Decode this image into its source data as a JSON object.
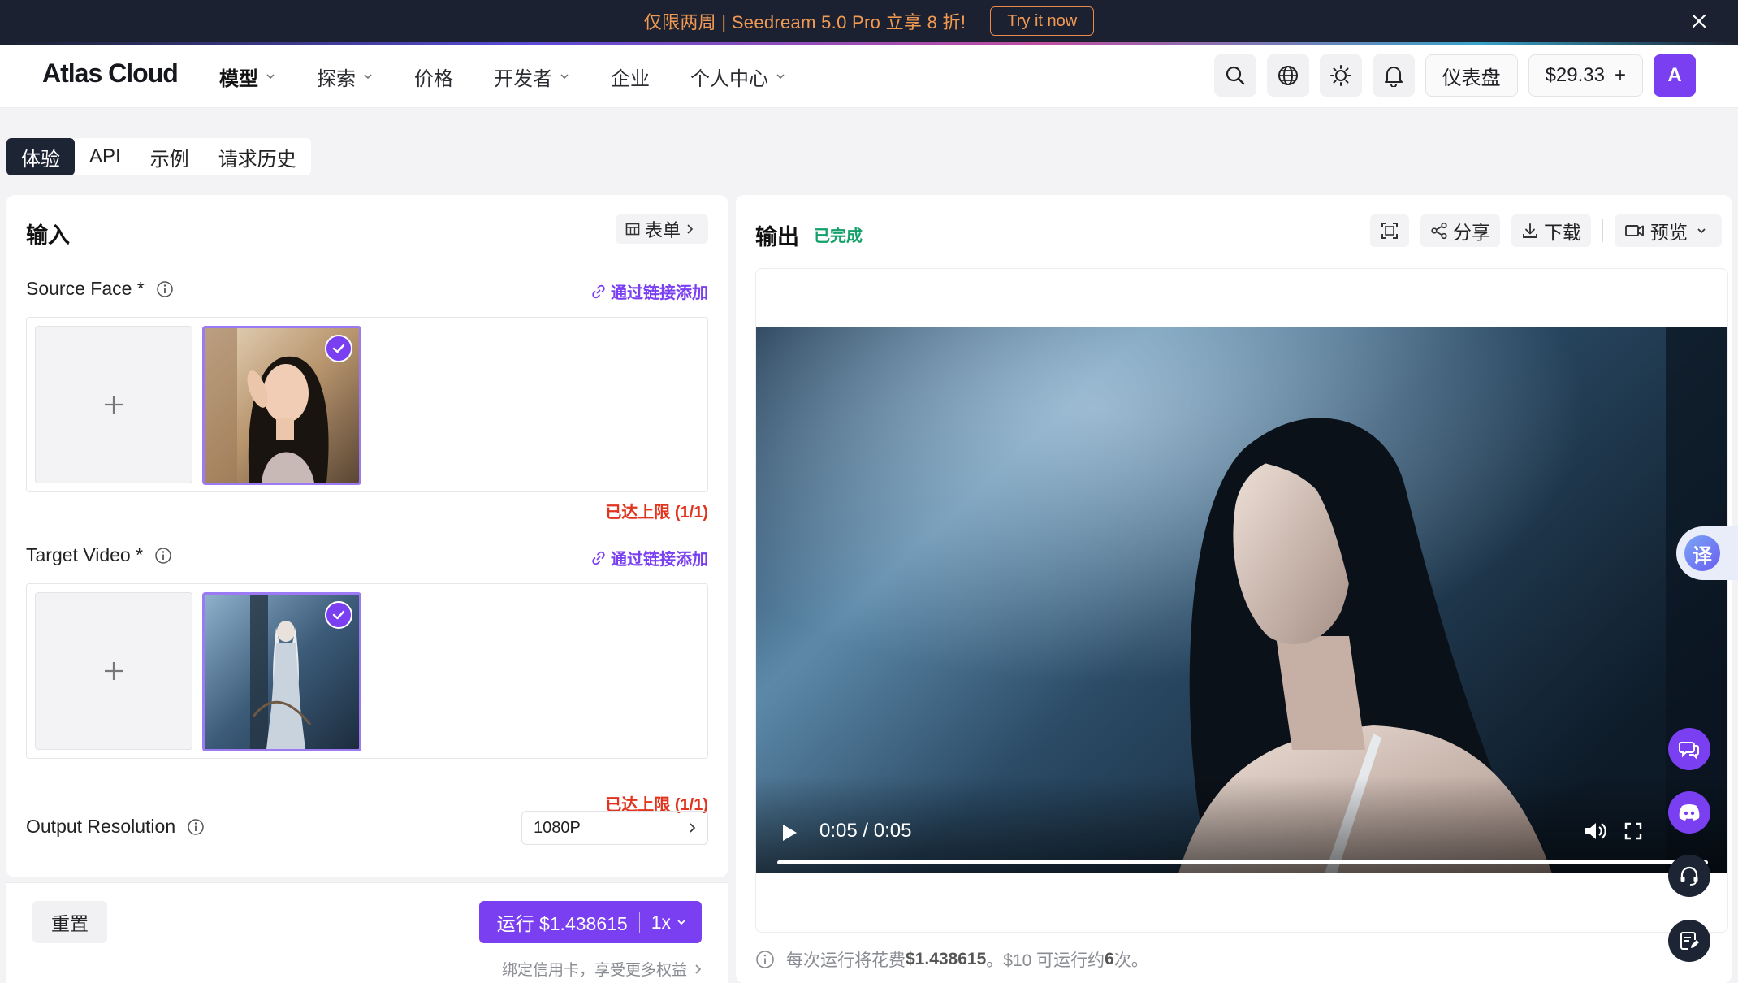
{
  "banner": {
    "text": "仅限两周 | Seedream 5.0 Pro 立享 8 折!",
    "cta": "Try it now"
  },
  "nav": {
    "logo": "Atlas Cloud",
    "menu": [
      {
        "label": "模型",
        "has_dropdown": true
      },
      {
        "label": "探索",
        "has_dropdown": true
      },
      {
        "label": "价格",
        "has_dropdown": false
      },
      {
        "label": "开发者",
        "has_dropdown": true
      },
      {
        "label": "企业",
        "has_dropdown": false
      },
      {
        "label": "个人中心",
        "has_dropdown": true
      }
    ],
    "dashboard": "仪表盘",
    "balance": "$29.33",
    "balance_plus": "+",
    "avatar_letter": "A"
  },
  "tabs": [
    "体验",
    "API",
    "示例",
    "请求历史"
  ],
  "input": {
    "title": "输入",
    "form_toggle": "表单",
    "source_face": {
      "label": "Source Face *",
      "link_add": "通过链接添加",
      "limit": "已达上限 (1/1)"
    },
    "target_video": {
      "label": "Target Video *",
      "link_add": "通过链接添加",
      "limit": "已达上限 (1/1)"
    },
    "resolution": {
      "label": "Output Resolution",
      "value": "1080P"
    },
    "reset": "重置",
    "run": "运行 $1.438615",
    "multiplier": "1x",
    "card_hint": "绑定信用卡，享受更多权益"
  },
  "output": {
    "title": "输出",
    "status": "已完成",
    "share": "分享",
    "download": "下载",
    "preview": "预览",
    "video_time": "0:05 / 0:05",
    "video_progress": 1.0,
    "cost_note_prefix": "每次运行将花费 ",
    "cost_amount": "$1.438615",
    "cost_note_mid": "。$10 可运行约 ",
    "cost_runs": "6",
    "cost_note_suffix": " 次。"
  },
  "floating": {
    "translate_glyph": "译"
  },
  "colors": {
    "accent": "#7b3ff2",
    "banner_bg": "#1b2130",
    "banner_text": "#f29a53",
    "success": "#14a06b",
    "error": "#e0341e"
  }
}
